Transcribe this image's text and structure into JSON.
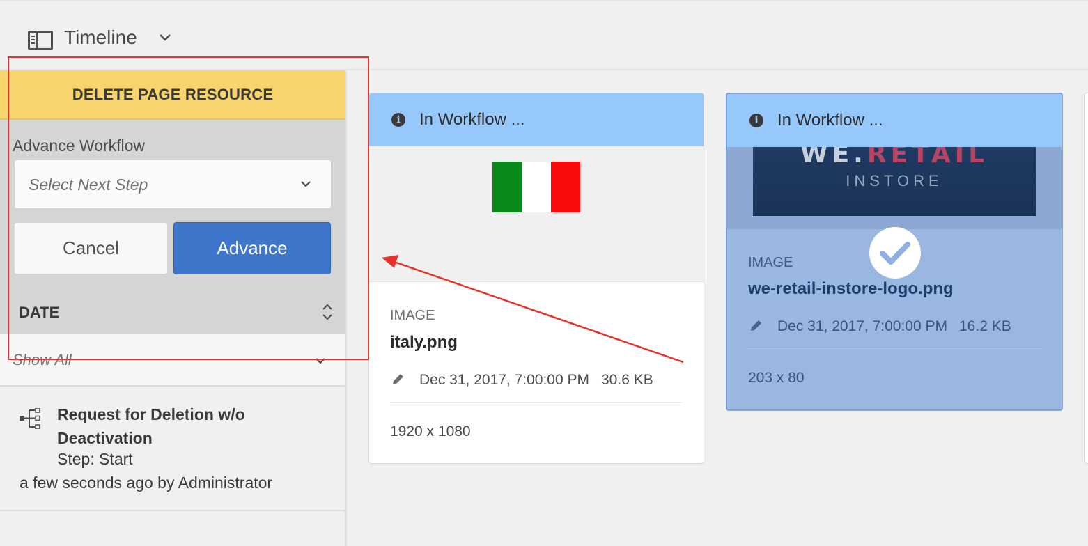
{
  "rail": {
    "title": "Timeline"
  },
  "workflow": {
    "header": "DELETE PAGE RESOURCE",
    "label": "Advance Workflow",
    "select_placeholder": "Select Next Step",
    "cancel_label": "Cancel",
    "advance_label": "Advance",
    "date_label": "DATE",
    "filter_value": "Show All"
  },
  "timeline_item": {
    "title": "Request for Deletion w/o Deactivation",
    "step": "Step: Start",
    "meta": "a few seconds ago by Administrator"
  },
  "cards": [
    {
      "status": "In Workflow ...",
      "type": "IMAGE",
      "name": "italy.png",
      "modified": "Dec 31, 2017, 7:00:00 PM",
      "size": "30.6 KB",
      "dimensions": "1920 x 1080",
      "flag_colors": [
        "#0a8a1c",
        "#ffffff",
        "#fb0c0c"
      ]
    },
    {
      "status": "In Workflow ...",
      "type": "IMAGE",
      "name": "we-retail-instore-logo.png",
      "modified": "Dec 31, 2017, 7:00:00 PM",
      "size": "16.2 KB",
      "dimensions": "203 x 80",
      "selected": true,
      "logo_text_1a": "WE.",
      "logo_text_1b": "RETAIL",
      "logo_text_2": "INSTORE"
    }
  ],
  "colors": {
    "workflow_header": "#f8d46c",
    "advance_button": "#3e76cc",
    "status_banner": "#96c8fb",
    "selected_card": "#9ab7e2",
    "annotation": "#e5322d"
  }
}
